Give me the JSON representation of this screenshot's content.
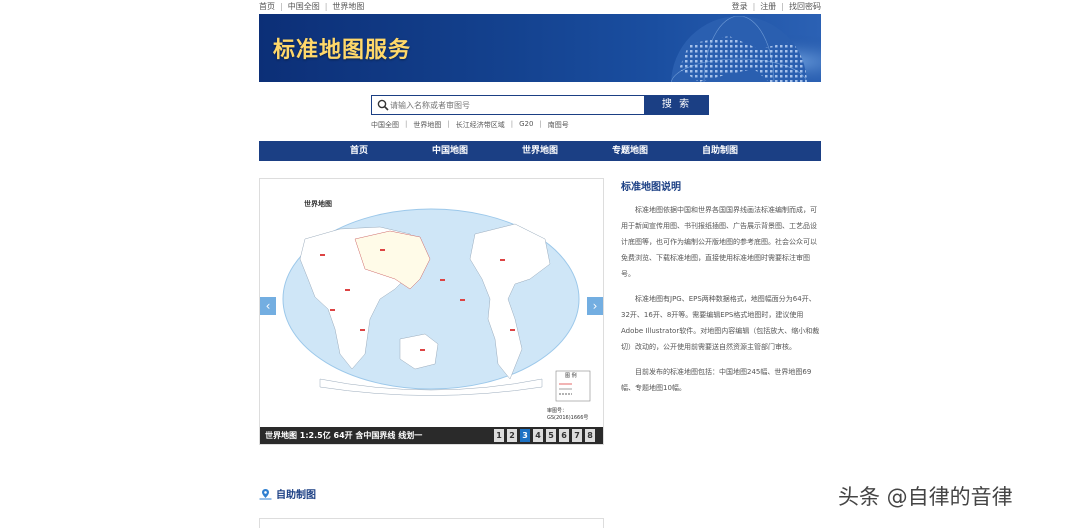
{
  "topbar": {
    "left_links": [
      "首页",
      "中国全图",
      "世界地图"
    ],
    "right_links": [
      "登录",
      "注册",
      "找回密码"
    ]
  },
  "banner": {
    "title": "标准地图服务"
  },
  "search": {
    "placeholder": "请输入名称或者审图号",
    "button_label": "搜 索",
    "quick_links": [
      "中国全图",
      "世界地图",
      "长江经济带区域",
      "G20",
      "南图号"
    ]
  },
  "nav": {
    "items": [
      "首页",
      "中国地图",
      "世界地图",
      "专题地图",
      "自助制图"
    ]
  },
  "slider": {
    "map_title": "世界地图",
    "legend_title": "图 例",
    "approval_no": "审图号：GS(2016)1666号",
    "caption": "世界地图 1:2.5亿 64开 含中国界线 线划一",
    "pages": [
      "1",
      "2",
      "3",
      "4",
      "5",
      "6",
      "7",
      "8"
    ],
    "active_page": "3",
    "prev_icon": "‹",
    "next_icon": "›"
  },
  "description": {
    "heading": "标准地图说明",
    "paragraphs": [
      "标准地图依据中国和世界各国国界线画法标准编制而成，可用于新闻宣传用图、书刊报纸插图、广告展示背景图、工艺品设计底图等，也可作为编制公开版地图的参考底图。社会公众可以免费浏览、下载标准地图，直接使用标准地图时需要标注审图号。",
      "标准地图有JPG、EPS两种数据格式，地图幅面分为64开、32开、16开、8开等。需要编辑EPS格式地图时，建议使用Adobe Illustrator软件。对地图内容编辑（包括放大、缩小和裁切）改动的，公开使用前需要送自然资源主管部门审核。",
      "目前发布的标准地图包括：中国地图245幅、世界地图69幅、专题地图10幅。"
    ]
  },
  "bottom": {
    "section_label": "自助制图"
  },
  "watermark": "头条 @自律的音律",
  "colors": {
    "navy": "#1b3f84",
    "gold": "#ffd86a",
    "ocean": "#cfe6f7",
    "active_page": "#1d72c4"
  }
}
